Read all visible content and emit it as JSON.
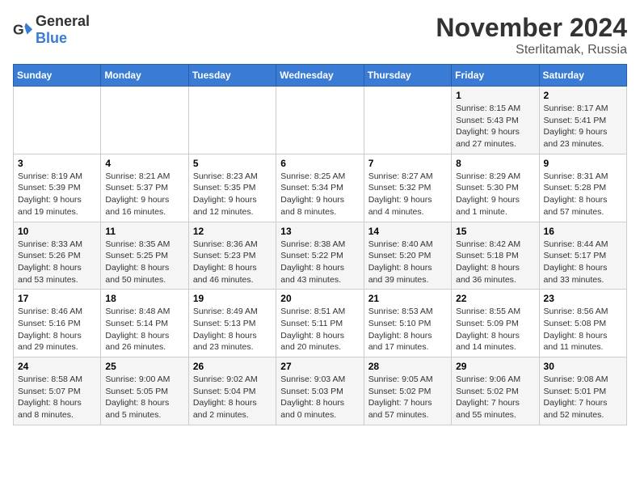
{
  "header": {
    "logo_general": "General",
    "logo_blue": "Blue",
    "month": "November 2024",
    "location": "Sterlitamak, Russia"
  },
  "days_of_week": [
    "Sunday",
    "Monday",
    "Tuesday",
    "Wednesday",
    "Thursday",
    "Friday",
    "Saturday"
  ],
  "weeks": [
    [
      {
        "day": "",
        "info": ""
      },
      {
        "day": "",
        "info": ""
      },
      {
        "day": "",
        "info": ""
      },
      {
        "day": "",
        "info": ""
      },
      {
        "day": "",
        "info": ""
      },
      {
        "day": "1",
        "info": "Sunrise: 8:15 AM\nSunset: 5:43 PM\nDaylight: 9 hours and 27 minutes."
      },
      {
        "day": "2",
        "info": "Sunrise: 8:17 AM\nSunset: 5:41 PM\nDaylight: 9 hours and 23 minutes."
      }
    ],
    [
      {
        "day": "3",
        "info": "Sunrise: 8:19 AM\nSunset: 5:39 PM\nDaylight: 9 hours and 19 minutes."
      },
      {
        "day": "4",
        "info": "Sunrise: 8:21 AM\nSunset: 5:37 PM\nDaylight: 9 hours and 16 minutes."
      },
      {
        "day": "5",
        "info": "Sunrise: 8:23 AM\nSunset: 5:35 PM\nDaylight: 9 hours and 12 minutes."
      },
      {
        "day": "6",
        "info": "Sunrise: 8:25 AM\nSunset: 5:34 PM\nDaylight: 9 hours and 8 minutes."
      },
      {
        "day": "7",
        "info": "Sunrise: 8:27 AM\nSunset: 5:32 PM\nDaylight: 9 hours and 4 minutes."
      },
      {
        "day": "8",
        "info": "Sunrise: 8:29 AM\nSunset: 5:30 PM\nDaylight: 9 hours and 1 minute."
      },
      {
        "day": "9",
        "info": "Sunrise: 8:31 AM\nSunset: 5:28 PM\nDaylight: 8 hours and 57 minutes."
      }
    ],
    [
      {
        "day": "10",
        "info": "Sunrise: 8:33 AM\nSunset: 5:26 PM\nDaylight: 8 hours and 53 minutes."
      },
      {
        "day": "11",
        "info": "Sunrise: 8:35 AM\nSunset: 5:25 PM\nDaylight: 8 hours and 50 minutes."
      },
      {
        "day": "12",
        "info": "Sunrise: 8:36 AM\nSunset: 5:23 PM\nDaylight: 8 hours and 46 minutes."
      },
      {
        "day": "13",
        "info": "Sunrise: 8:38 AM\nSunset: 5:22 PM\nDaylight: 8 hours and 43 minutes."
      },
      {
        "day": "14",
        "info": "Sunrise: 8:40 AM\nSunset: 5:20 PM\nDaylight: 8 hours and 39 minutes."
      },
      {
        "day": "15",
        "info": "Sunrise: 8:42 AM\nSunset: 5:18 PM\nDaylight: 8 hours and 36 minutes."
      },
      {
        "day": "16",
        "info": "Sunrise: 8:44 AM\nSunset: 5:17 PM\nDaylight: 8 hours and 33 minutes."
      }
    ],
    [
      {
        "day": "17",
        "info": "Sunrise: 8:46 AM\nSunset: 5:16 PM\nDaylight: 8 hours and 29 minutes."
      },
      {
        "day": "18",
        "info": "Sunrise: 8:48 AM\nSunset: 5:14 PM\nDaylight: 8 hours and 26 minutes."
      },
      {
        "day": "19",
        "info": "Sunrise: 8:49 AM\nSunset: 5:13 PM\nDaylight: 8 hours and 23 minutes."
      },
      {
        "day": "20",
        "info": "Sunrise: 8:51 AM\nSunset: 5:11 PM\nDaylight: 8 hours and 20 minutes."
      },
      {
        "day": "21",
        "info": "Sunrise: 8:53 AM\nSunset: 5:10 PM\nDaylight: 8 hours and 17 minutes."
      },
      {
        "day": "22",
        "info": "Sunrise: 8:55 AM\nSunset: 5:09 PM\nDaylight: 8 hours and 14 minutes."
      },
      {
        "day": "23",
        "info": "Sunrise: 8:56 AM\nSunset: 5:08 PM\nDaylight: 8 hours and 11 minutes."
      }
    ],
    [
      {
        "day": "24",
        "info": "Sunrise: 8:58 AM\nSunset: 5:07 PM\nDaylight: 8 hours and 8 minutes."
      },
      {
        "day": "25",
        "info": "Sunrise: 9:00 AM\nSunset: 5:05 PM\nDaylight: 8 hours and 5 minutes."
      },
      {
        "day": "26",
        "info": "Sunrise: 9:02 AM\nSunset: 5:04 PM\nDaylight: 8 hours and 2 minutes."
      },
      {
        "day": "27",
        "info": "Sunrise: 9:03 AM\nSunset: 5:03 PM\nDaylight: 8 hours and 0 minutes."
      },
      {
        "day": "28",
        "info": "Sunrise: 9:05 AM\nSunset: 5:02 PM\nDaylight: 7 hours and 57 minutes."
      },
      {
        "day": "29",
        "info": "Sunrise: 9:06 AM\nSunset: 5:02 PM\nDaylight: 7 hours and 55 minutes."
      },
      {
        "day": "30",
        "info": "Sunrise: 9:08 AM\nSunset: 5:01 PM\nDaylight: 7 hours and 52 minutes."
      }
    ]
  ]
}
